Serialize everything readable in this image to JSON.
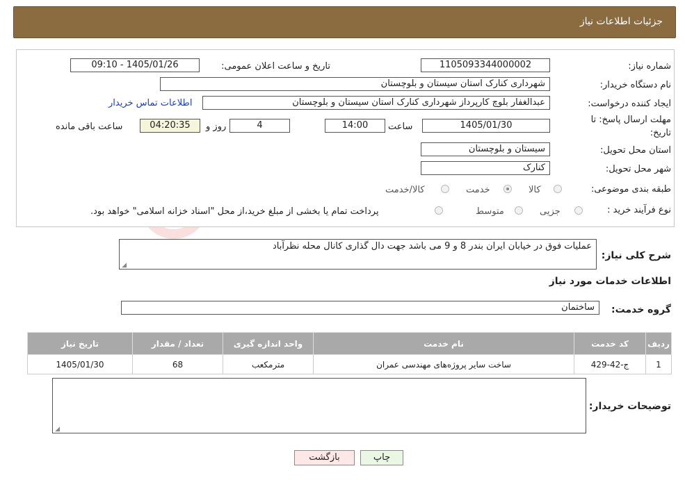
{
  "header": {
    "title": "جزئیات اطلاعات نیاز"
  },
  "form": {
    "need_number_label": "شماره نیاز:",
    "need_number": "1105093344000002",
    "announce_label": "تاریخ و ساعت اعلان عمومی:",
    "announce_value": "1405/01/26 - 09:10",
    "buyer_label": "نام دستگاه خریدار:",
    "buyer_value": "شهرداری کنارک استان سیستان و بلوچستان",
    "creator_label": "ایجاد کننده درخواست:",
    "creator_value": "عبدالغفار بلوچ کارپرداز شهرداری کنارک استان سیستان و بلوچستان",
    "contact_link": "اطلاعات تماس خریدار",
    "deadline_label_1": "مهلت ارسال پاسخ: تا",
    "deadline_label_2": "تاریخ:",
    "deadline_date": "1405/01/30",
    "time_label": "ساعت",
    "deadline_time": "14:00",
    "days_value": "4",
    "days_label": "روز و",
    "remaining_value": "04:20:35",
    "remaining_label": "ساعت باقی مانده",
    "province_label": "استان محل تحویل:",
    "province_value": "سیستان و بلوچستان",
    "city_label": "شهر محل تحویل:",
    "city_value": "کنارک",
    "category_label": "طبقه بندی موضوعی:",
    "category_options": [
      "کالا",
      "خدمت",
      "کالا/خدمت"
    ],
    "category_selected": "خدمت",
    "process_label": "نوع فرآیند خرید :",
    "process_options": [
      "جزیی",
      "متوسط"
    ],
    "process_note": "پرداخت تمام یا بخشی از مبلغ خرید،از محل \"اسناد خزانه اسلامی\" خواهد بود."
  },
  "summary": {
    "label": "شرح کلی نیاز:",
    "value": "عملیات فوق در خیابان ایران بندر 8 و 9 می باشد جهت دال گذاری کانال محله نظرآباد"
  },
  "services": {
    "section_title": "اطلاعات خدمات مورد نیاز",
    "group_label": "گروه خدمت:",
    "group_value": "ساختمان",
    "columns": [
      "ردیف",
      "کد خدمت",
      "نام خدمت",
      "واحد اندازه گیری",
      "تعداد / مقدار",
      "تاریخ نیاز"
    ],
    "rows": [
      [
        "1",
        "ج-42-429",
        "ساخت سایر پروژه‌های مهندسی عمران",
        "مترمکعب",
        "68",
        "1405/01/30"
      ]
    ]
  },
  "buyer_notes": {
    "label": "توضیحات خریدار:",
    "value": ""
  },
  "buttons": {
    "print": "چاپ",
    "back": "بازگشت"
  },
  "watermark": {
    "text": "AriaTender.neT"
  },
  "colors": {
    "header_bg": "#8b6c40",
    "table_header_bg": "#a9a9a9",
    "print_btn_bg": "#eaf7e4",
    "back_btn_bg": "#fde7e7",
    "link": "#1a3fb5"
  }
}
